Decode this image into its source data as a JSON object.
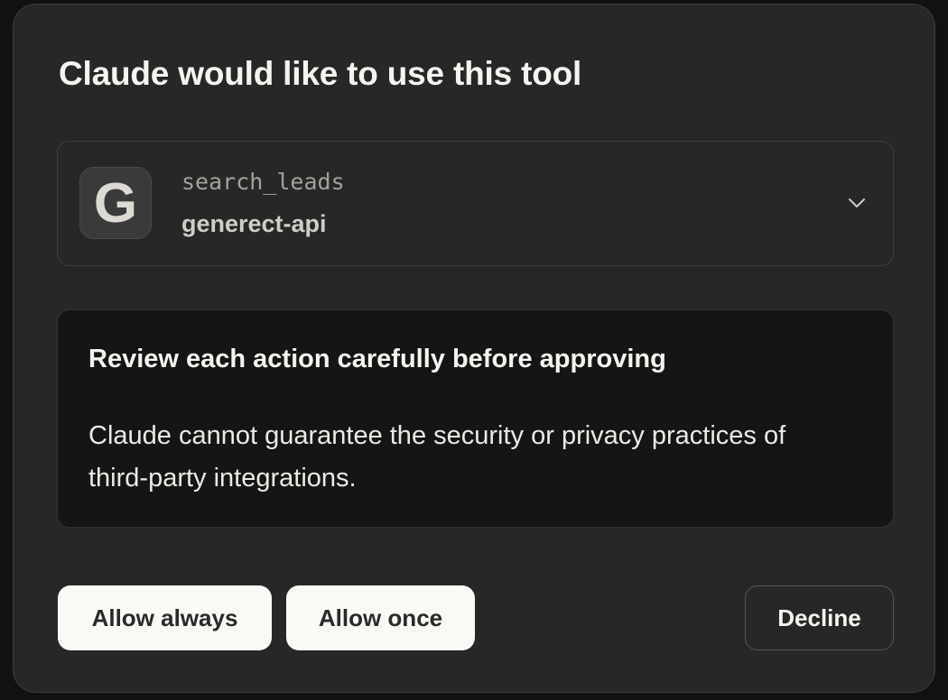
{
  "dialog": {
    "title": "Claude would like to use this tool"
  },
  "tool": {
    "logo_letter": "G",
    "name": "search_leads",
    "server": "generect-api",
    "expand_icon": "chevron-down-icon"
  },
  "warning": {
    "title": "Review each action carefully before approving",
    "body": "Claude cannot guarantee the security or privacy practices of third-party integrations."
  },
  "actions": {
    "allow_always": "Allow always",
    "allow_once": "Allow once",
    "decline": "Decline"
  },
  "colors": {
    "background": "#111111",
    "dialog": "#272727",
    "warning_box": "#151515",
    "primary_button": "#faf9f5"
  }
}
